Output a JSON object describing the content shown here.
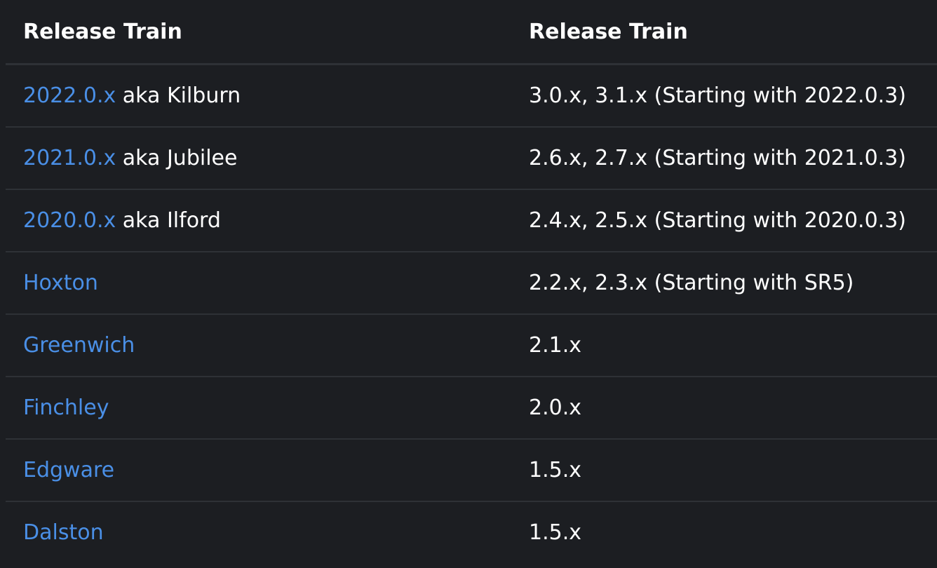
{
  "table": {
    "headers": [
      "Release Train",
      "Release Train"
    ],
    "rows": [
      {
        "link": "2022.0.x",
        "suffix": " aka Kilburn",
        "value": "3.0.x, 3.1.x (Starting with 2022.0.3)"
      },
      {
        "link": "2021.0.x",
        "suffix": " aka Jubilee",
        "value": "2.6.x, 2.7.x (Starting with 2021.0.3)"
      },
      {
        "link": "2020.0.x",
        "suffix": " aka Ilford",
        "value": "2.4.x, 2.5.x (Starting with 2020.0.3)"
      },
      {
        "link": "Hoxton",
        "suffix": "",
        "value": "2.2.x, 2.3.x (Starting with SR5)"
      },
      {
        "link": "Greenwich",
        "suffix": "",
        "value": "2.1.x"
      },
      {
        "link": "Finchley",
        "suffix": "",
        "value": "2.0.x"
      },
      {
        "link": "Edgware",
        "suffix": "",
        "value": "1.5.x"
      },
      {
        "link": "Dalston",
        "suffix": "",
        "value": "1.5.x"
      }
    ]
  },
  "colors": {
    "background": "#1c1e22",
    "text": "#ffffff",
    "link": "#4a8fe6",
    "divider": "#2e3136"
  }
}
